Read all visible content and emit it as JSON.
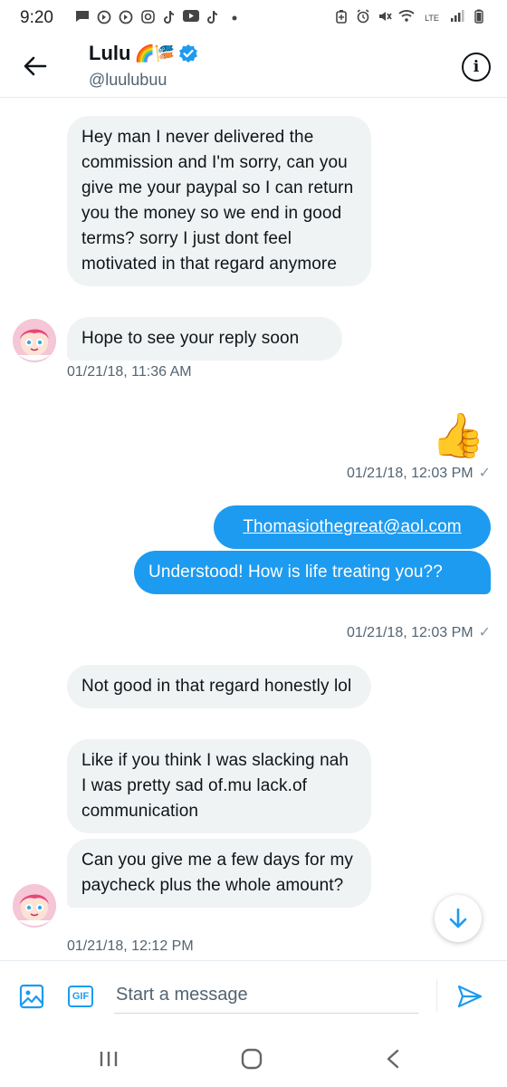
{
  "status_bar": {
    "time": "9:20",
    "network_label": "LTE",
    "left_icons": [
      "message-icon",
      "media-icon",
      "media-icon",
      "instagram-icon",
      "tiktok-icon",
      "youtube-icon",
      "tiktok-icon",
      "dot-icon"
    ],
    "right_icons": [
      "battery-saver-icon",
      "alarm-icon",
      "mute-icon",
      "wifi-icon",
      "lte-icon",
      "signal-icon",
      "battery-icon"
    ]
  },
  "header": {
    "display_name": "Lulu",
    "name_emojis": "🌈🎏",
    "handle": "@luulubuu",
    "verified": true,
    "back_icon": "arrow-left-icon",
    "info_icon": "info-icon",
    "info_glyph": "i"
  },
  "messages": [
    {
      "id": "m1",
      "direction": "incoming",
      "text": "Hey man I never delivered the commission and I'm sorry, can you give me your paypal so I can return you the money so we end in good terms? sorry I just dont feel motivated in that regard anymore"
    },
    {
      "id": "m2",
      "direction": "incoming",
      "text": "Hope to see your reply soon",
      "timestamp": "01/21/18, 11:36 AM"
    },
    {
      "id": "m3",
      "direction": "outgoing",
      "emoji": "👍",
      "timestamp": "01/21/18, 12:03 PM",
      "status": "✓"
    },
    {
      "id": "m4",
      "direction": "outgoing",
      "text": "Thomasiothegreat@aol.com",
      "is_link": true
    },
    {
      "id": "m5",
      "direction": "outgoing",
      "text": "Understood! How is life treating you??",
      "timestamp": "01/21/18, 12:03 PM",
      "status": "✓"
    },
    {
      "id": "m6",
      "direction": "incoming",
      "text": "Not good in that regard honestly lol"
    },
    {
      "id": "m7",
      "direction": "incoming",
      "text": "Like if you think I was slacking nah I was pretty sad of.mu lack.of communication"
    },
    {
      "id": "m8",
      "direction": "incoming",
      "text": "Can you give me a few days for my paycheck plus the whole amount?",
      "timestamp": "01/21/18, 12:12 PM"
    }
  ],
  "composer": {
    "placeholder": "Start a message",
    "gif_label": "GIF",
    "image_icon": "image-icon",
    "send_icon": "send-icon"
  },
  "nav": {
    "recents_icon": "recents-icon",
    "home_icon": "home-icon",
    "back_icon": "back-icon"
  },
  "colors": {
    "accent": "#1d9bf0",
    "incoming_bubble": "#eff3f4",
    "text_primary": "#0f1419",
    "text_secondary": "#536471"
  }
}
